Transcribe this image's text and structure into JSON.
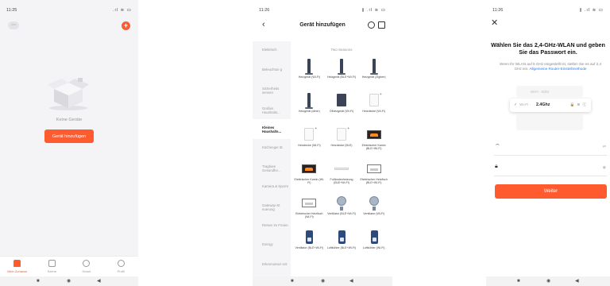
{
  "colors": {
    "accent": "#ff5b2e",
    "link": "#2e7cf6",
    "check": "#26a65b"
  },
  "screen1": {
    "status": {
      "time": "11:25",
      "icons": ".ıl ≋ ▭"
    },
    "empty_text": "Keine Geräte",
    "add_button": "Gerät hinzufügen",
    "tabs": [
      {
        "label": "Mein Zuhause",
        "icon": "home-icon",
        "active": true
      },
      {
        "label": "Szene",
        "icon": "scene-icon",
        "active": false
      },
      {
        "label": "Smart",
        "icon": "smart-icon",
        "active": false
      },
      {
        "label": "Profil",
        "icon": "profile-icon",
        "active": false
      }
    ]
  },
  "screen2": {
    "status": {
      "time": "11:26",
      "icons": "∦ .ıl ≋ ▭"
    },
    "title": "Gerät hinzufügen",
    "categories": [
      {
        "label": "Elektrisch",
        "selected": false
      },
      {
        "label": "Beleuchtun g",
        "selected": false
      },
      {
        "label": "Sicherheits sensen",
        "selected": false
      },
      {
        "label": "Großes Haushalts...",
        "selected": false
      },
      {
        "label": "Kleines Haushalts...",
        "selected": true
      },
      {
        "label": "Küchenger ät",
        "selected": false
      },
      {
        "label": "Tragbare Gesundhe...",
        "selected": false
      },
      {
        "label": "Kamera & Sperre",
        "selected": false
      },
      {
        "label": "Gateway-St euerung",
        "selected": false
      },
      {
        "label": "Reisen im Freien",
        "selected": false
      },
      {
        "label": "Energy",
        "selected": false
      },
      {
        "label": "Erkennunser ent",
        "selected": false
      }
    ],
    "subhead": "Two Seasons",
    "devices": [
      {
        "label": "Heizgerät (Wi-Fi)",
        "thumb": "rad"
      },
      {
        "label": "Heizgerät (BLE+Wi-Fi)",
        "thumb": "rad"
      },
      {
        "label": "Heizgerät (Zigbee)",
        "thumb": "rad"
      },
      {
        "label": "Heizgerät (other)",
        "thumb": "rad"
      },
      {
        "label": "Ölheizgerät (Wi-Fi)",
        "thumb": "flat"
      },
      {
        "label": "Heizdecke (Wi-Fi)",
        "thumb": "white"
      },
      {
        "label": "Heizdecke (Wi-Fi)",
        "thumb": "white"
      },
      {
        "label": "Heizdecke (BLE)",
        "thumb": "white"
      },
      {
        "label": "Elektrischer Kamin (BLE+Wi-Fi)",
        "thumb": "fire"
      },
      {
        "label": "Elektrischer Kamin (Wi-Fi)",
        "thumb": "fire"
      },
      {
        "label": "Fußbodenheizung (BLE+Wi-Fi)",
        "thumb": "strip"
      },
      {
        "label": "Elektrischer Heizfisch (BLE+Wi-Fi)",
        "thumb": "pfire"
      },
      {
        "label": "Elektrischer Heizfisch (Wi-Fi)",
        "thumb": "pfire"
      },
      {
        "label": "Ventilator (BLE+Wi-Fi)",
        "thumb": "fan"
      },
      {
        "label": "Ventilator (Wi-Fi)",
        "thumb": "fan"
      },
      {
        "label": "Ventilator (BLE+Wi-Fi)",
        "thumb": "cooler"
      },
      {
        "label": "Luftkühler (BLE+Wi-Fi)",
        "thumb": "cooler"
      },
      {
        "label": "Luftkühler (Wi-Fi)",
        "thumb": "cooler"
      }
    ]
  },
  "screen3": {
    "status": {
      "time": "11:26",
      "icons": "∦ .ıl ≋ ▭"
    },
    "title": "Wählen Sie das 2,4-GHz-WLAN und geben Sie das Passwort ein.",
    "desc": "Wenn Ihr WLAN auf 5 GHz eingestellt ist, stellen Sie es auf 2,4 GHz ein.",
    "link": "Allgemeine Router-Einstellmethode",
    "ghost_row": "Wi-Fi · 5Ghz",
    "wifi_label": "Wi-Fi ·",
    "wifi_band": "2.4Ghz",
    "wifi_right": "🔒 ≋ ⓘ",
    "ssid_right": "⇄",
    "pw_right": "◉",
    "button": "Weiter"
  }
}
